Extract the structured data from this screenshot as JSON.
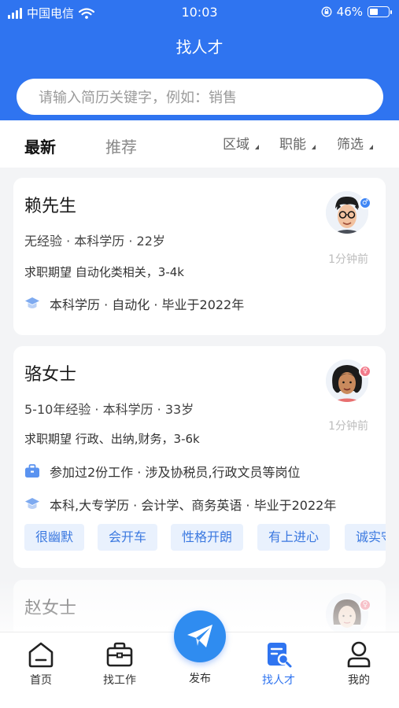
{
  "status_bar": {
    "carrier": "中国电信",
    "time": "10:03",
    "battery_percent": "46%",
    "battery_level": 0.46
  },
  "header": {
    "title": "找人才"
  },
  "search": {
    "placeholder": "请输入简历关键字，例如：销售"
  },
  "filter_bar": {
    "tabs": [
      {
        "label": "最新",
        "active": true
      },
      {
        "label": "推荐",
        "active": false
      }
    ],
    "filters": [
      {
        "label": "区域"
      },
      {
        "label": "职能"
      },
      {
        "label": "筛选"
      }
    ]
  },
  "candidates": [
    {
      "name": "赖先生",
      "summary": "无经验 · 本科学历 · 22岁",
      "expectation": "求职期望  自动化类相关，3-4k",
      "education": "本科学历 · 自动化 · 毕业于2022年",
      "time": "1分钟前",
      "gender": "male"
    },
    {
      "name": "骆女士",
      "summary": "5-10年经验 · 本科学历 · 33岁",
      "expectation": "求职期望  行政、出纳,财务，3-6k",
      "work": "参加过2份工作 · 涉及协税员,行政文员等岗位",
      "education": "本科,大专学历 · 会计学、商务英语 · 毕业于2022年",
      "time": "1分钟前",
      "gender": "female",
      "tags": [
        "很幽默",
        "会开车",
        "性格开朗",
        "有上进心",
        "诚实守信"
      ]
    },
    {
      "name": "赵女士",
      "gender": "female"
    }
  ],
  "tabbar": {
    "items": [
      {
        "label": "首页",
        "icon": "home-icon"
      },
      {
        "label": "找工作",
        "icon": "briefcase-icon"
      },
      {
        "label": "发布",
        "icon": "paper-plane-icon"
      },
      {
        "label": "找人才",
        "icon": "talent-search-icon",
        "active": true
      },
      {
        "label": "我的",
        "icon": "user-icon"
      }
    ]
  },
  "colors": {
    "primary": "#2f74f0",
    "tag_bg": "#e9f1fd",
    "tag_text": "#3a78e0",
    "male_badge": "#3f86f5",
    "female_badge": "#f27a8a"
  }
}
